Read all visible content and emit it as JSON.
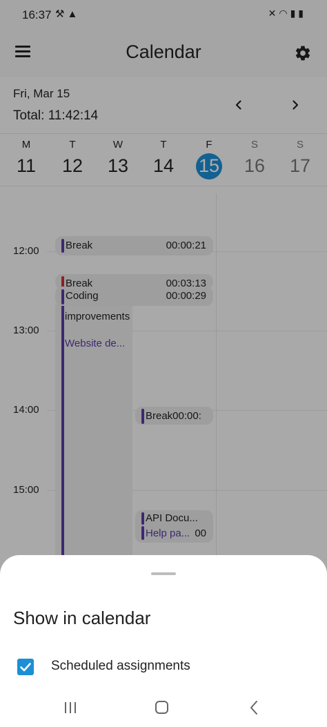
{
  "status_bar": {
    "time": "16:37",
    "left_icons": [
      "magic-wand-icon",
      "warning-icon"
    ],
    "right_icons": [
      "mute-icon",
      "wifi-icon",
      "signal-icon",
      "battery-icon"
    ]
  },
  "app_bar": {
    "title": "Calendar",
    "menu_icon": "hamburger-menu-icon",
    "settings_icon": "gear-icon"
  },
  "date_header": {
    "date": "Fri, Mar 15",
    "total": "Total: 11:42:14",
    "prev_icon": "chevron-left-icon",
    "next_icon": "chevron-right-icon"
  },
  "week": [
    {
      "letter": "M",
      "num": "11"
    },
    {
      "letter": "T",
      "num": "12"
    },
    {
      "letter": "W",
      "num": "13"
    },
    {
      "letter": "T",
      "num": "14"
    },
    {
      "letter": "F",
      "num": "15",
      "selected": true
    },
    {
      "letter": "S",
      "num": "16"
    },
    {
      "letter": "S",
      "num": "17"
    }
  ],
  "hours": [
    "12:00",
    "13:00",
    "14:00",
    "15:00"
  ],
  "events": {
    "break1": {
      "title": "Break",
      "duration": "00:00:21"
    },
    "break2": {
      "title": "Break",
      "duration": "00:03:13",
      "bar_color": "#d32f2f"
    },
    "coding": {
      "title": "Coding",
      "duration": "00:00:29"
    },
    "improvements": {
      "title": "improvements",
      "subtitle": "Website de..."
    },
    "break3": {
      "title": "Break00:00:"
    },
    "api_docs": {
      "title": "API Docu...",
      "subtitle": "Help pa...",
      "duration": "00"
    }
  },
  "colors": {
    "accent": "#1c8fd6",
    "event_bar": "#5b3ba8"
  },
  "sheet": {
    "title": "Show in calendar",
    "option_label": "Scheduled assignments",
    "option_checked": true
  },
  "nav_bar": {
    "icons": [
      "recents-icon",
      "home-icon",
      "back-icon"
    ]
  }
}
